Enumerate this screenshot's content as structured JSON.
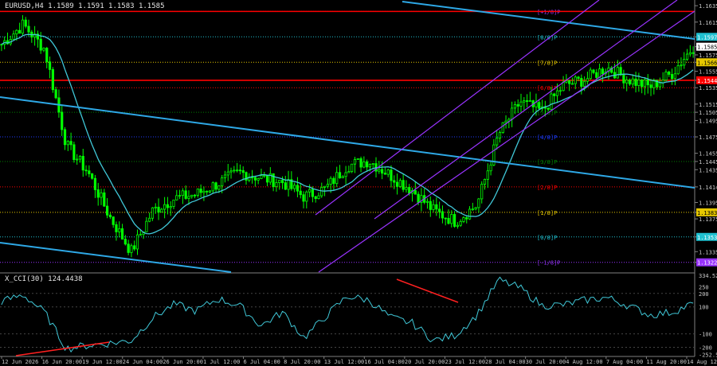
{
  "header": {
    "symbol_info": "EURUSD,H4  1.1589 1.1591 1.1583 1.1585",
    "cci_title": "X_CCI(30) 124.4438"
  },
  "colors": {
    "background": "#000000",
    "candle": "#00ff00",
    "moving_average": "#40c8d8",
    "channel_blue": "#2ea8e6",
    "channel_purple": "#9933ff",
    "red_level": "#ff0000",
    "divergence_line": "#ff2020",
    "cci_line": "#40c8d8",
    "grid": "#c8c8c8"
  },
  "chart_data": [
    {
      "type": "candlestick",
      "title": "EURUSD,H4",
      "ohlc_last": {
        "open": 1.1589,
        "high": 1.1591,
        "low": 1.1583,
        "close": 1.1585
      },
      "ylim": [
        1.1312,
        1.164
      ],
      "y_ticks": [
        "1.1635",
        "1.1615",
        "1.1597",
        "1.1585",
        "1.1575",
        "1.1566",
        "1.1555",
        "1.1544",
        "1.1535",
        "1.1515",
        "1.1505",
        "1.1495",
        "1.1475",
        "1.1455",
        "1.1445",
        "1.1435",
        "1.1414",
        "1.1395",
        "1.1383",
        "1.1375",
        "1.1353",
        "1.1335",
        "1.1322"
      ],
      "price_labels": [
        {
          "text": "1.1597",
          "bg": "#20c0d0"
        },
        {
          "text": "1.1585",
          "bg": "#ffffff"
        },
        {
          "text": "1.1566",
          "bg": "#e6c800"
        },
        {
          "text": "1.1544",
          "bg": "#ff0000"
        },
        {
          "text": "1.1383",
          "bg": "#e6c800"
        },
        {
          "text": "1.1353",
          "bg": "#20c0d0"
        },
        {
          "text": "1.1322",
          "bg": "#9933ff"
        }
      ],
      "x_ticks": [
        "12 Jun 2026",
        "16 Jun 20:00",
        "19 Jun 12:00",
        "24 Jun 04:00",
        "26 Jun 20:00",
        "1 Jul 12:00",
        "6 Jul 04:00",
        "8 Jul 20:00",
        "13 Jul 12:00",
        "16 Jul 04:00",
        "20 Jul 20:00",
        "23 Jul 12:00",
        "28 Jul 04:00",
        "30 Jul 20:00",
        "4 Aug 12:00",
        "7 Aug 04:00",
        "11 Aug 20:00",
        "14 Aug 12:00"
      ],
      "murrey_levels": [
        {
          "label": "[8/8]P",
          "price": 1.1597,
          "color": "#20c0d0"
        },
        {
          "label": "[7/8]P",
          "price": 1.1566,
          "color": "#e6c800"
        },
        {
          "label": "[6/8]P",
          "price": 1.1535,
          "color": "#ff0000"
        },
        {
          "label": "[5/8]P",
          "price": 1.1505,
          "color": "#008000"
        },
        {
          "label": "[4/8]P",
          "price": 1.1475,
          "color": "#1f3cff"
        },
        {
          "label": "[3/8]P",
          "price": 1.1445,
          "color": "#008000"
        },
        {
          "label": "[2/8]P",
          "price": 1.1414,
          "color": "#ff0000"
        },
        {
          "label": "[1/8]P",
          "price": 1.1383,
          "color": "#e6c800"
        },
        {
          "label": "[0/8]P",
          "price": 1.1353,
          "color": "#20c0d0"
        },
        {
          "label": "[-1/8]P",
          "price": 1.1322,
          "color": "#9933ff"
        }
      ],
      "extra_levels": [
        {
          "label": "[+1/8]P",
          "price": 1.1628,
          "color": "#9933ff"
        }
      ],
      "red_horizontal_levels": [
        1.1628,
        1.1544
      ],
      "close_path": [
        {
          "date": "12 Jun 2026",
          "close": 1.1588
        },
        {
          "date": "15 Jun 00:00",
          "close": 1.1612
        },
        {
          "date": "16 Jun 20:00",
          "close": 1.1582
        },
        {
          "date": "18 Jun 00:00",
          "close": 1.1465
        },
        {
          "date": "19 Jun 12:00",
          "close": 1.1432
        },
        {
          "date": "22 Jun 08:00",
          "close": 1.1378
        },
        {
          "date": "24 Jun 04:00",
          "close": 1.1335
        },
        {
          "date": "25 Jun 12:00",
          "close": 1.1385
        },
        {
          "date": "26 Jun 20:00",
          "close": 1.14
        },
        {
          "date": "30 Jun 04:00",
          "close": 1.1405
        },
        {
          "date": "1 Jul 12:00",
          "close": 1.1418
        },
        {
          "date": "3 Jul 00:00",
          "close": 1.1432
        },
        {
          "date": "6 Jul 04:00",
          "close": 1.1425
        },
        {
          "date": "8 Jul 20:00",
          "close": 1.142
        },
        {
          "date": "10 Jul 08:00",
          "close": 1.1402
        },
        {
          "date": "13 Jul 12:00",
          "close": 1.1412
        },
        {
          "date": "15 Jul 00:00",
          "close": 1.144
        },
        {
          "date": "16 Jul 04:00",
          "close": 1.1446
        },
        {
          "date": "17 Jul 20:00",
          "close": 1.1428
        },
        {
          "date": "20 Jul 20:00",
          "close": 1.141
        },
        {
          "date": "23 Jul 12:00",
          "close": 1.1385
        },
        {
          "date": "27 Jul 00:00",
          "close": 1.1372
        },
        {
          "date": "28 Jul 04:00",
          "close": 1.1392
        },
        {
          "date": "29 Jul 08:00",
          "close": 1.1478
        },
        {
          "date": "30 Jul 20:00",
          "close": 1.1518
        },
        {
          "date": "3 Aug 00:00",
          "close": 1.1506
        },
        {
          "date": "4 Aug 12:00",
          "close": 1.1538
        },
        {
          "date": "6 Aug 00:00",
          "close": 1.1545
        },
        {
          "date": "7 Aug 04:00",
          "close": 1.156
        },
        {
          "date": "10 Aug 00:00",
          "close": 1.1545
        },
        {
          "date": "11 Aug 20:00",
          "close": 1.1536
        },
        {
          "date": "13 Aug 04:00",
          "close": 1.1552
        },
        {
          "date": "14 Aug 12:00",
          "close": 1.1585
        }
      ]
    },
    {
      "type": "line",
      "title": "X_CCI(30) 124.4438",
      "last_value": 124.4438,
      "ylim": [
        -250,
        334.5265
      ],
      "y_ticks": [
        "334.5265",
        "250",
        "200",
        "100",
        "-100",
        "-200",
        "-252.5700"
      ],
      "divergence_lines": 2,
      "cci_path": [
        {
          "date": "12 Jun 2026",
          "value": 140
        },
        {
          "date": "15 Jun 00:00",
          "value": 190
        },
        {
          "date": "16 Jun 20:00",
          "value": 60
        },
        {
          "date": "18 Jun 00:00",
          "value": -210
        },
        {
          "date": "19 Jun 12:00",
          "value": -185
        },
        {
          "date": "22 Jun 08:00",
          "value": -170
        },
        {
          "date": "24 Jun 04:00",
          "value": -150
        },
        {
          "date": "25 Jun 12:00",
          "value": 20
        },
        {
          "date": "26 Jun 20:00",
          "value": 120
        },
        {
          "date": "30 Jun 04:00",
          "value": 70
        },
        {
          "date": "1 Jul 12:00",
          "value": 160
        },
        {
          "date": "3 Jul 00:00",
          "value": 110
        },
        {
          "date": "6 Jul 04:00",
          "value": -40
        },
        {
          "date": "8 Jul 20:00",
          "value": 60
        },
        {
          "date": "10 Jul 08:00",
          "value": -130
        },
        {
          "date": "13 Jul 12:00",
          "value": 30
        },
        {
          "date": "15 Jul 00:00",
          "value": 180
        },
        {
          "date": "16 Jul 04:00",
          "value": 150
        },
        {
          "date": "17 Jul 20:00",
          "value": 20
        },
        {
          "date": "20 Jul 20:00",
          "value": -20
        },
        {
          "date": "23 Jul 12:00",
          "value": -150
        },
        {
          "date": "27 Jul 00:00",
          "value": -110
        },
        {
          "date": "28 Jul 04:00",
          "value": 40
        },
        {
          "date": "29 Jul 08:00",
          "value": 300
        },
        {
          "date": "30 Jul 20:00",
          "value": 240
        },
        {
          "date": "3 Aug 00:00",
          "value": 110
        },
        {
          "date": "4 Aug 12:00",
          "value": 115
        },
        {
          "date": "6 Aug 00:00",
          "value": 150
        },
        {
          "date": "7 Aug 04:00",
          "value": 170
        },
        {
          "date": "10 Aug 00:00",
          "value": 110
        },
        {
          "date": "11 Aug 20:00",
          "value": 40
        },
        {
          "date": "13 Aug 04:00",
          "value": 60
        },
        {
          "date": "14 Aug 12:00",
          "value": 124.44
        }
      ]
    }
  ]
}
